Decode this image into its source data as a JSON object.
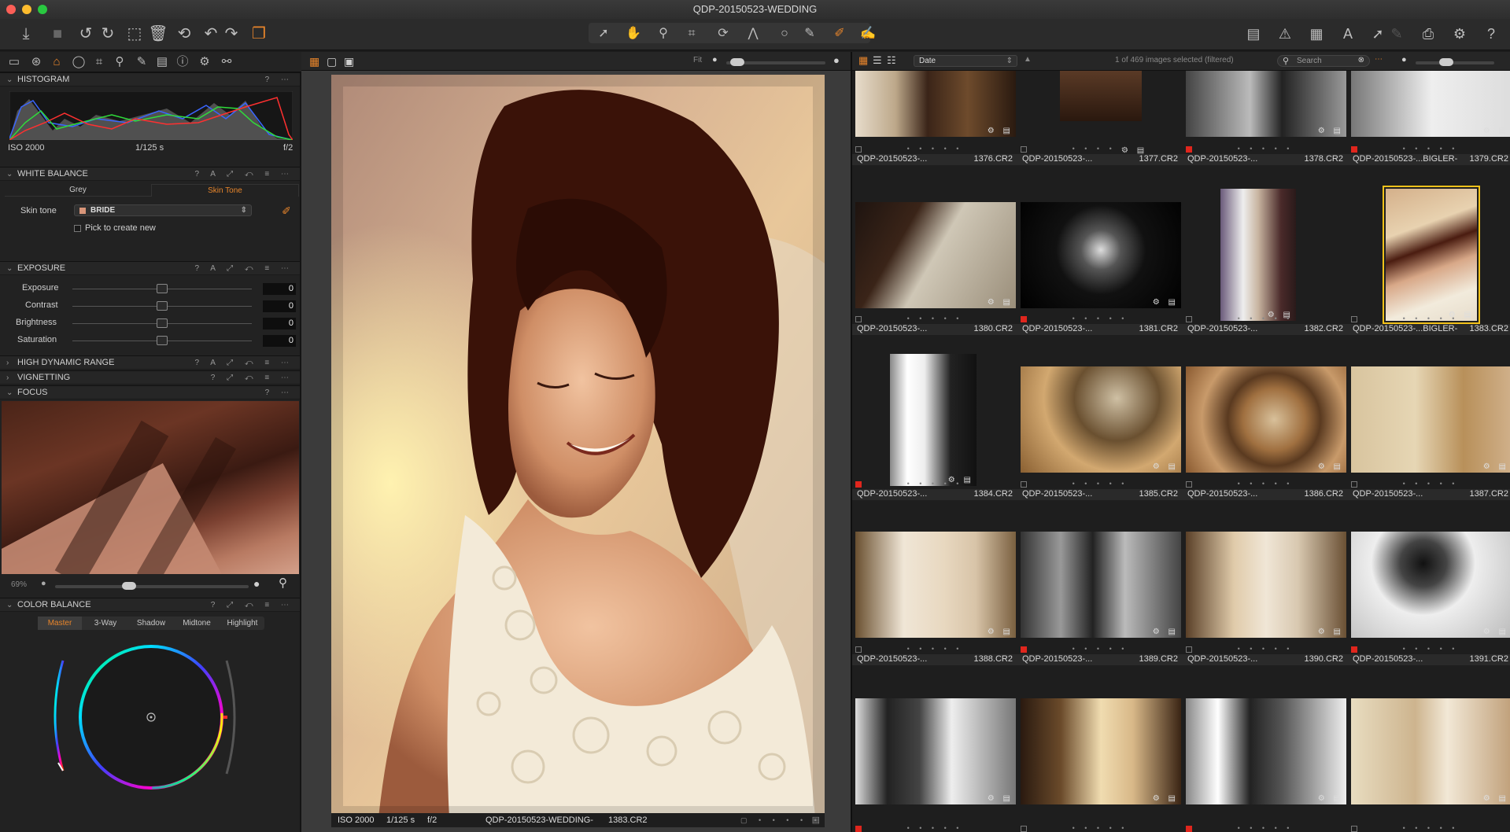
{
  "window": {
    "title": "QDP-20150523-WEDDING"
  },
  "histogram": {
    "header": "HISTOGRAM",
    "iso": "ISO 2000",
    "shutter": "1/125 s",
    "aperture": "f/2"
  },
  "white_balance": {
    "header": "WHITE BALANCE",
    "tab_grey": "Grey",
    "tab_skin": "Skin Tone",
    "skin_label": "Skin tone",
    "skin_value": "BRIDE",
    "pick_new": "Pick to create new"
  },
  "exposure": {
    "header": "EXPOSURE",
    "rows": [
      {
        "label": "Exposure",
        "value": "0"
      },
      {
        "label": "Contrast",
        "value": "0"
      },
      {
        "label": "Brightness",
        "value": "0"
      },
      {
        "label": "Saturation",
        "value": "0"
      }
    ]
  },
  "hdr": {
    "header": "HIGH DYNAMIC RANGE"
  },
  "vignetting": {
    "header": "VIGNETTING"
  },
  "focus": {
    "header": "FOCUS",
    "zoom": "69%"
  },
  "color_balance": {
    "header": "COLOR BALANCE",
    "tabs": [
      "Master",
      "3-Way",
      "Shadow",
      "Midtone",
      "Highlight"
    ]
  },
  "viewer": {
    "fit": "Fit",
    "iso": "ISO 2000",
    "shutter": "1/125 s",
    "aperture": "f/2",
    "file_left": "QDP-20150523-WEDDING-",
    "file_right": "1383.CR2"
  },
  "browser": {
    "sort": "Date",
    "count": "1 of 469 images selected (filtered)",
    "search_placeholder": "Search",
    "rows": [
      [
        {
          "name": "QDP-20150523-...",
          "num": "1376.CR2",
          "tag": "none"
        },
        {
          "name": "QDP-20150523-...",
          "num": "1377.CR2",
          "tag": "none"
        },
        {
          "name": "QDP-20150523-...",
          "num": "1378.CR2",
          "tag": "red"
        },
        {
          "name": "QDP-20150523-...BIGLER-",
          "num": "1379.CR2",
          "tag": "red"
        }
      ],
      [
        {
          "name": "QDP-20150523-...",
          "num": "1380.CR2",
          "tag": "none"
        },
        {
          "name": "QDP-20150523-...",
          "num": "1381.CR2",
          "tag": "red"
        },
        {
          "name": "QDP-20150523-...",
          "num": "1382.CR2",
          "tag": "none"
        },
        {
          "name": "QDP-20150523-...BIGLER-",
          "num": "1383.CR2",
          "tag": "none"
        }
      ],
      [
        {
          "name": "QDP-20150523-...",
          "num": "1384.CR2",
          "tag": "red"
        },
        {
          "name": "QDP-20150523-...",
          "num": "1385.CR2",
          "tag": "none"
        },
        {
          "name": "QDP-20150523-...",
          "num": "1386.CR2",
          "tag": "none"
        },
        {
          "name": "QDP-20150523-...",
          "num": "1387.CR2",
          "tag": "none"
        }
      ],
      [
        {
          "name": "QDP-20150523-...",
          "num": "1388.CR2",
          "tag": "none"
        },
        {
          "name": "QDP-20150523-...",
          "num": "1389.CR2",
          "tag": "red"
        },
        {
          "name": "QDP-20150523-...",
          "num": "1390.CR2",
          "tag": "none"
        },
        {
          "name": "QDP-20150523-...",
          "num": "1391.CR2",
          "tag": "red"
        }
      ]
    ]
  }
}
